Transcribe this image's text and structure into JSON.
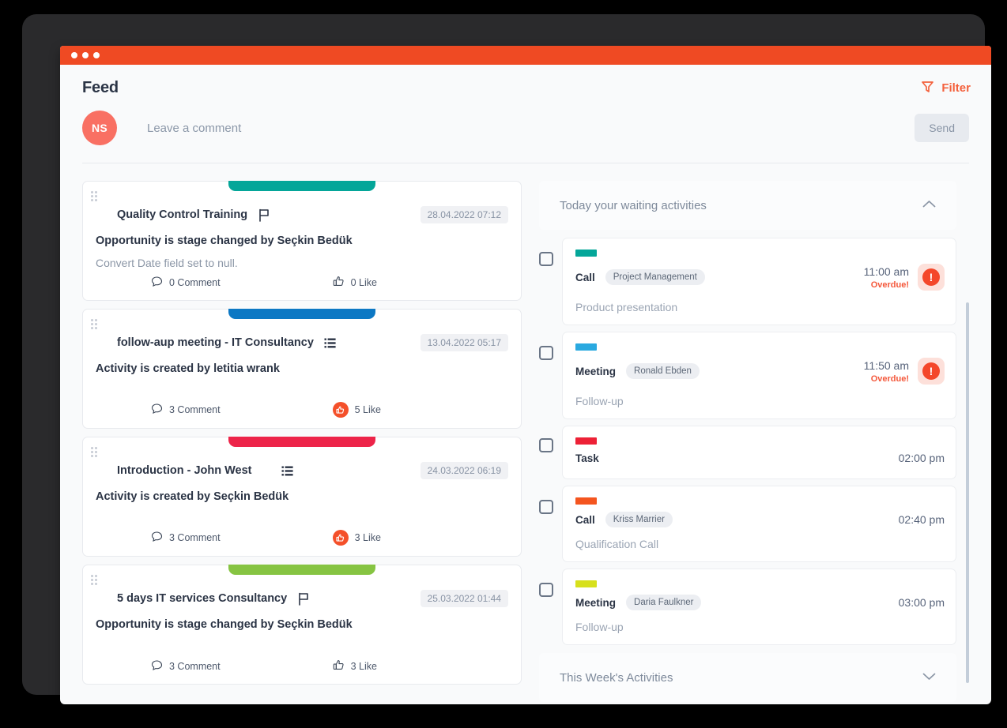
{
  "window": {
    "titlebar_color": "#ef4a23",
    "dots": 3
  },
  "header": {
    "title": "Feed",
    "filter_label": "Filter",
    "filter_icon": "filter-funnel-icon",
    "accent_color": "#f4613d"
  },
  "composer": {
    "avatar_initials": "NS",
    "avatar_color": "#f97063",
    "placeholder": "Leave a comment",
    "value": "",
    "send_label": "Send"
  },
  "feed": {
    "cards": [
      {
        "color": "#04a699",
        "title": "Quality Control Training",
        "type_icon": "flag-icon",
        "date": "28.04.2022 07:12",
        "main_text": "Opportunity is stage changed by Seçkin Bedük",
        "sub_text": "Convert Date field set to null.",
        "comment_count": "0 Comment",
        "like_count": "0 Like",
        "liked": false
      },
      {
        "color": "#0c78c4",
        "title": "follow-aup meeting - IT Consultancy",
        "type_icon": "list-icon",
        "date": "13.04.2022 05:17",
        "main_text": "Activity is created by letitia wrank",
        "sub_text": "",
        "comment_count": "3 Comment",
        "like_count": "5 Like",
        "liked": true
      },
      {
        "color": "#ed2449",
        "title": "Introduction - John West",
        "type_icon": "list-icon",
        "date": "24.03.2022 06:19",
        "main_text": "Activity is created by Seçkin Bedük",
        "sub_text": "",
        "comment_count": "3 Comment",
        "like_count": "3 Like",
        "liked": true
      },
      {
        "color": "#86c442",
        "title": "5 days IT services Consultancy",
        "type_icon": "flag-icon",
        "date": "25.03.2022 01:44",
        "main_text": "Opportunity is stage changed by Seçkin Bedük",
        "sub_text": "",
        "comment_count": "3 Comment",
        "like_count": "3 Like",
        "liked": false
      }
    ]
  },
  "activities": {
    "panel_title": "Today your waiting activities",
    "panel_chevron": "chevron-up-icon",
    "footer_title": "This Week's Activities",
    "footer_chevron": "chevron-down-icon",
    "items": [
      {
        "color": "#04a699",
        "type": "Call",
        "chip": "Project Management",
        "time": "11:00 am",
        "overdue_label": "Overdue!",
        "overdue": true,
        "note": "Product presentation",
        "checked": false
      },
      {
        "color": "#2aa9e0",
        "type": "Meeting",
        "chip": "Ronald Ebden",
        "time": "11:50 am",
        "overdue_label": "Overdue!",
        "overdue": true,
        "note": "Follow-up",
        "checked": false
      },
      {
        "color": "#ed2136",
        "type": "Task",
        "chip": "",
        "time": "02:00 pm",
        "overdue_label": "",
        "overdue": false,
        "note": "",
        "checked": false
      },
      {
        "color": "#f4551f",
        "type": "Call",
        "chip": "Kriss Marrier",
        "time": "02:40 pm",
        "overdue_label": "",
        "overdue": false,
        "note": "Qualification Call",
        "checked": false
      },
      {
        "color": "#d7e01c",
        "type": "Meeting",
        "chip": "Daria Faulkner",
        "time": "03:00 pm",
        "overdue_label": "",
        "overdue": false,
        "note": "Follow-up",
        "checked": false
      }
    ]
  }
}
